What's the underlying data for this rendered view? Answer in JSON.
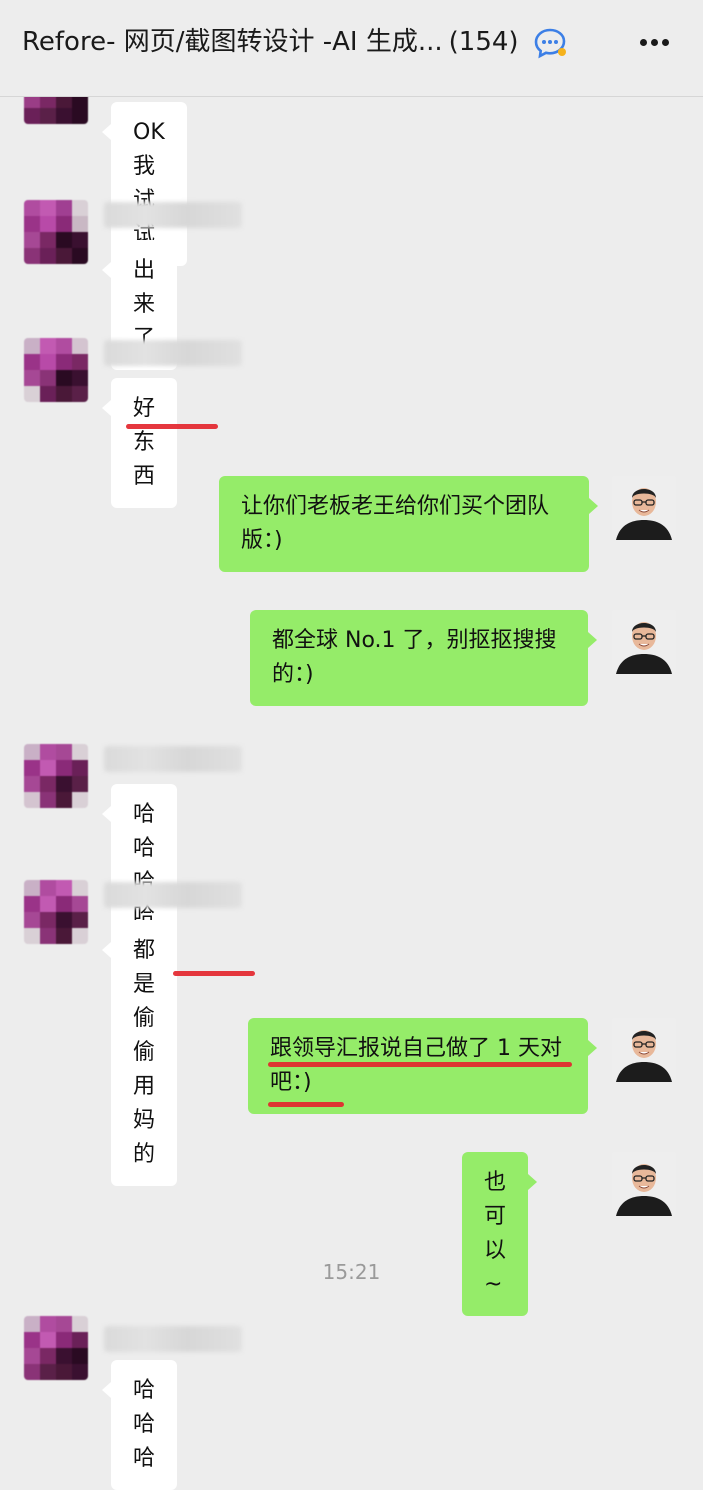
{
  "header": {
    "title": "Refore- 网页/截图转设计 -AI 生成...",
    "count": "(154)",
    "chat_icon": "chat-bubble-icon",
    "more_icon": "more-dots-icon"
  },
  "messages": [
    {
      "side": "left",
      "text": "OK 我试试"
    },
    {
      "side": "left",
      "text": "出来了"
    },
    {
      "side": "left",
      "text": "好东西"
    },
    {
      "side": "right",
      "text": "让你们老板老王给你们买个团队\n版：)"
    },
    {
      "side": "right",
      "text": "都全球 No.1 了，别抠抠搜搜\n的：)"
    },
    {
      "side": "left",
      "text": "哈哈哈哈"
    },
    {
      "side": "left",
      "text": "都是偷偷用妈的"
    },
    {
      "side": "right",
      "text": "跟领导汇报说自己做了 1 天对\n吧：)"
    },
    {
      "side": "right",
      "text": "也可以~"
    },
    {
      "side": "left",
      "text": "哈哈哈"
    }
  ],
  "timestamp": "15:21",
  "colors": {
    "background": "#ededed",
    "left_bubble": "#ffffff",
    "right_bubble": "#95ec69",
    "annotation": "#e3262e",
    "timestamp": "#9a9a9a"
  }
}
